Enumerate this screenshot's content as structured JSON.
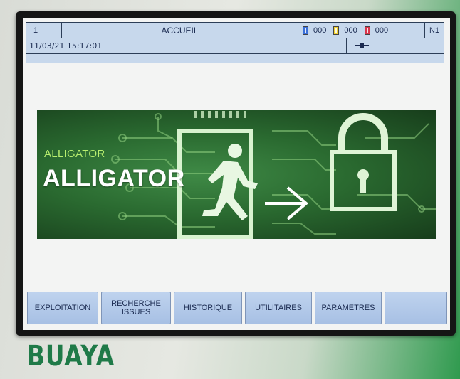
{
  "header": {
    "page_number": "1",
    "title": "ACCUEIL",
    "datetime": "11/03/21 15:17:01",
    "message": "",
    "level": "N1",
    "counters": [
      {
        "icon": "battery-blue-icon",
        "color": "#3a6fd8",
        "value": "000"
      },
      {
        "icon": "battery-yellow-icon",
        "color": "#f2d231",
        "value": "000"
      },
      {
        "icon": "battery-red-icon",
        "color": "#d8344a",
        "value": "000"
      }
    ],
    "network_icon": "network-connector-icon"
  },
  "banner": {
    "logo_small": "ALLIGATOR",
    "logo_big": "ALLIGATOR",
    "icons": [
      "emergency-exit-runner-icon",
      "arrow-right-icon",
      "padlock-icon"
    ]
  },
  "menu": {
    "exploitation": "EXPLOITATION",
    "recherche": "RECHERCHE ISSUES",
    "historique": "HISTORIQUE",
    "utilitaires": "UTILITAIRES",
    "parametres": "PARAMETRES",
    "blank": ""
  },
  "brand": "BUAYA",
  "colors": {
    "header_bg": "#c7d8ec",
    "button_bg": "#bfd3ee",
    "banner_green": "#2a6a30",
    "brand_green": "#1f7a48"
  }
}
